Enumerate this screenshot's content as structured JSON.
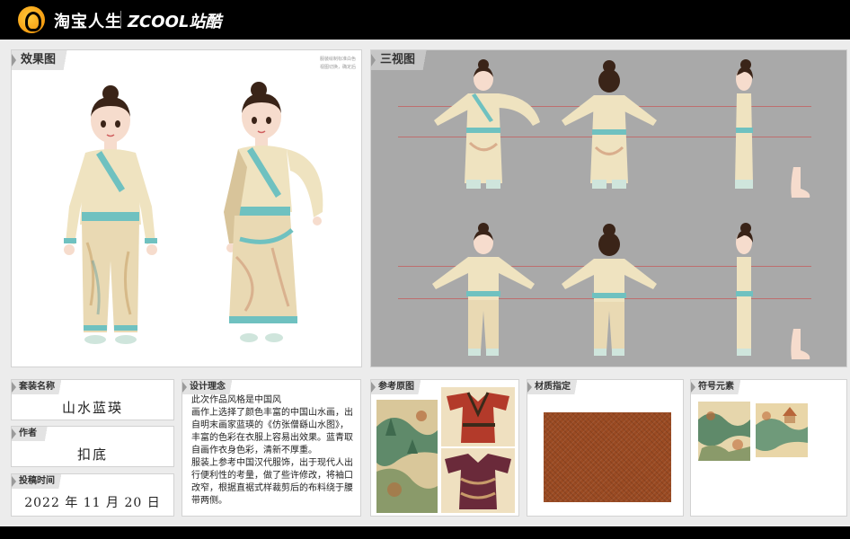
{
  "header": {
    "brand_cn": "淘宝人生",
    "brand_zcool": "ZCOOL站酷"
  },
  "effect": {
    "title": "效果图",
    "note_line1": "服装绘制标准白色",
    "note_line2": "视图切换，确定后"
  },
  "three_view": {
    "title": "三视图"
  },
  "suit": {
    "label": "套装名称",
    "value": "山水蓝瑛"
  },
  "author": {
    "label": "作者",
    "value": "扣底"
  },
  "date": {
    "label": "投稿时间",
    "value": "2022 年 11 月 20 日"
  },
  "concept": {
    "label": "设计理念",
    "paragraphs": [
      "此次作品风格是中国风",
      "画作上选择了颜色丰富的中国山水画，出自明末画家蓝瑛的《仿张僧繇山水图》，丰富的色彩在衣服上容易出效果。蓝青取自画作衣身色彩，清新不厚重。",
      "服装上参考中国汉代服饰，出于现代人出行便利性的考量，做了些许修改，将袖口改窄，根据直裾式样裁剪后的布料绕于腰带两侧。"
    ]
  },
  "reference": {
    "label": "参考原图"
  },
  "material": {
    "label": "材质指定"
  },
  "symbol": {
    "label": "符号元素"
  },
  "colors": {
    "accent": "#6fc1c0",
    "fabric_cream": "#efe3c0",
    "hair": "#3a2418",
    "background_gray": "#a9a9a9"
  }
}
